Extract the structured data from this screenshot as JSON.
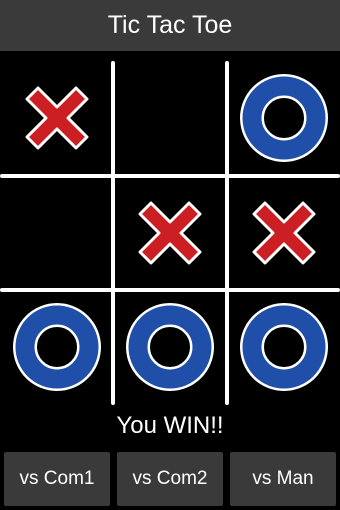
{
  "header": {
    "title": "Tic Tac Toe"
  },
  "board": {
    "cells": [
      [
        "X",
        "",
        "O"
      ],
      [
        "",
        "X",
        "X"
      ],
      [
        "O",
        "O",
        "O"
      ]
    ]
  },
  "status_text": "You WIN!!",
  "buttons": [
    {
      "label": "vs Com1"
    },
    {
      "label": "vs Com2"
    },
    {
      "label": "vs Man"
    }
  ],
  "colors": {
    "x_mark": "#cc1f24",
    "o_mark": "#1f4fa8",
    "mark_outline": "#ffffff",
    "background": "#000000",
    "bar": "#3a3a3a"
  }
}
